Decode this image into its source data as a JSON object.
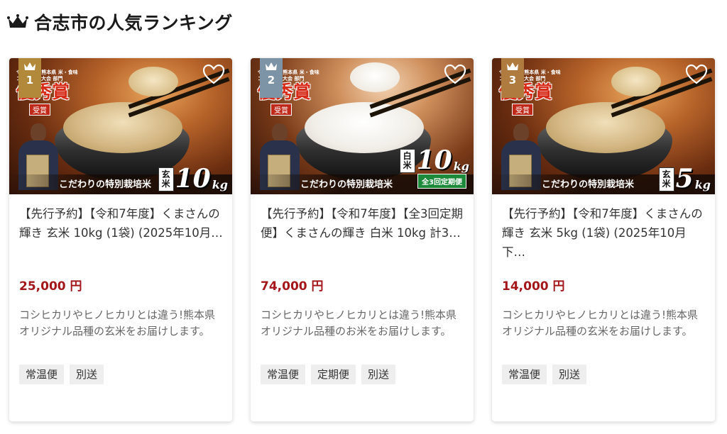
{
  "header": {
    "title": "合志市の人気ランキング",
    "icon": "crown-icon"
  },
  "colors": {
    "price": "#a3171b",
    "gold": "#b2893a",
    "silver": "#7d93a6",
    "bronze": "#b07b3f"
  },
  "cards": [
    {
      "rank": "1",
      "name": "【先行予約】【令和7年度】くまさんの輝き 玄米 10kg (1袋) (2025年10月…",
      "price": "25,000 円",
      "description": "コシヒカリやヒノヒカリとは違う!熊本県オリジナル品種の玄米をお届けします。",
      "tags": [
        "常温便",
        "別送"
      ],
      "image": {
        "award_sub": "令和6年度 熊本県 米・食味コンクール大会 部門",
        "award_main": "優秀賞",
        "award_small": "受賞",
        "banner": "こだわりの特別栽培米",
        "type": "玄米",
        "weight": "10",
        "unit": "kg"
      }
    },
    {
      "rank": "2",
      "name": "【先行予約】【令和7年度】【全3回定期便】くまさんの輝き 白米 10kg 計3…",
      "price": "74,000 円",
      "description": "コシヒカリやヒノヒカリとは違う!熊本県オリジナル品種のお米をお届けします。",
      "tags": [
        "常温便",
        "定期便",
        "別送"
      ],
      "image": {
        "award_sub": "令和6年度 熊本県 米・食味コンクール大会 部門",
        "award_main": "優秀賞",
        "award_small": "受賞",
        "banner": "こだわりの特別栽培米",
        "type": "白米",
        "weight": "10",
        "unit": "kg",
        "plan": "全3回定期便"
      }
    },
    {
      "rank": "3",
      "name": "【先行予約】【令和7年度】くまさんの輝き 玄米 5kg (1袋) (2025年10月下…",
      "price": "14,000 円",
      "description": "コシヒカリやヒノヒカリとは違う!熊本県オリジナル品種の玄米をお届けします。",
      "tags": [
        "常温便",
        "別送"
      ],
      "image": {
        "award_sub": "令和6年度 熊本県 米・食味コンクール大会 部門",
        "award_main": "優秀賞",
        "award_small": "受賞",
        "banner": "こだわりの特別栽培米",
        "type": "玄米",
        "weight": "5",
        "unit": "kg"
      }
    }
  ]
}
